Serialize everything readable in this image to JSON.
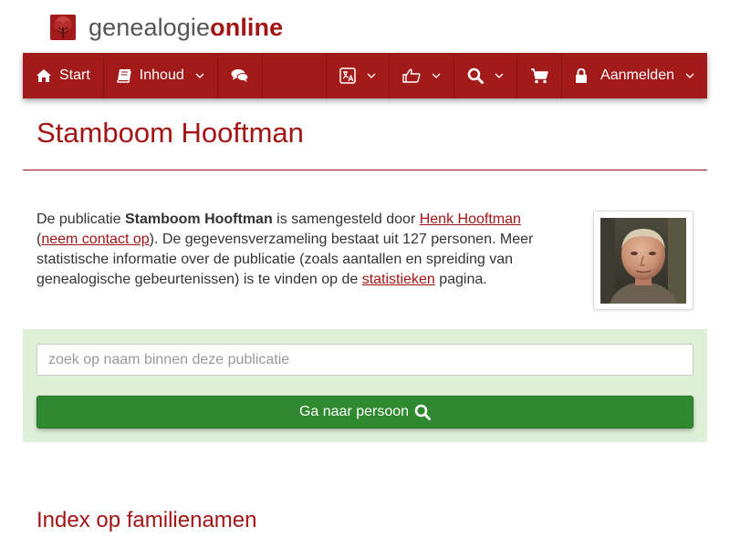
{
  "brand": {
    "light": "genealogie",
    "bold": "online"
  },
  "nav": {
    "start": "Start",
    "contents": "Inhoud",
    "login": "Aanmelden",
    "icons": {
      "start": "home-icon",
      "contents": "book-icon",
      "chat": "comments-icon",
      "language": "translate-icon",
      "share": "thumbs-up-icon",
      "search": "search-icon",
      "cart": "shopping-cart-icon",
      "login": "lock-icon"
    }
  },
  "page": {
    "title": "Stamboom Hooftman"
  },
  "intro": {
    "text_1": "De publicatie ",
    "publication": "Stamboom Hooftman",
    "text_2": " is samengesteld door ",
    "author": "Henk Hooftman",
    "text_3": "(",
    "contact": "neem contact op",
    "text_4": "). De gegevensverzameling bestaat uit 127 personen. Meer statistische informatie over de publicatie (zoals aantallen en spreiding van genealogische gebeurtenissen) is te vinden op de ",
    "stats_link": "statistieken",
    "text_5": " pagina."
  },
  "search": {
    "placeholder": "zoek op naam binnen deze publicatie",
    "value": "",
    "button": "Ga naar persoon"
  },
  "index": {
    "heading": "Index op familienamen"
  },
  "colors": {
    "brand_red": "#a21a1a",
    "link_red": "#a31515",
    "panel_green": "#dff0d8",
    "button_green": "#2f8a2f"
  }
}
